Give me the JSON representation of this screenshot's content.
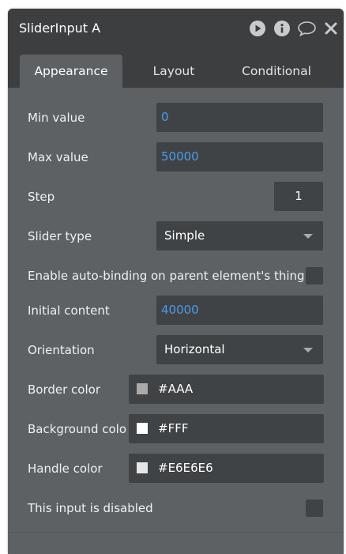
{
  "window": {
    "title": "SliderInput A"
  },
  "header_icons": [
    "play-icon",
    "info-icon",
    "comment-icon",
    "close-icon"
  ],
  "tabs": [
    {
      "label": "Appearance",
      "active": true
    },
    {
      "label": "Layout",
      "active": false
    },
    {
      "label": "Conditional",
      "active": false
    }
  ],
  "fields": {
    "min_value": {
      "label": "Min value",
      "value": "0"
    },
    "max_value": {
      "label": "Max value",
      "value": "50000"
    },
    "step": {
      "label": "Step",
      "value": "1"
    },
    "slider_type": {
      "label": "Slider type",
      "value": "Simple"
    },
    "auto_binding": {
      "label": "Enable auto-binding on parent element's thing",
      "checked": false
    },
    "initial_content": {
      "label": "Initial content",
      "value": "40000"
    },
    "orientation": {
      "label": "Orientation",
      "value": "Horizontal"
    },
    "border_color": {
      "label": "Border color",
      "value": "#AAA",
      "swatch": "#AAAAAA"
    },
    "background_color": {
      "label": "Background colo",
      "value": "#FFF",
      "swatch": "#FFFFFF"
    },
    "handle_color": {
      "label": "Handle color",
      "value": "#E6E6E6",
      "swatch": "#E6E6E6"
    },
    "disabled": {
      "label": "This input is disabled",
      "checked": false
    }
  },
  "colors": {
    "panel_bg": "#5d6164",
    "header_bg": "#3c3e40",
    "field_bg": "#404345",
    "link_value": "#4a9bea"
  }
}
